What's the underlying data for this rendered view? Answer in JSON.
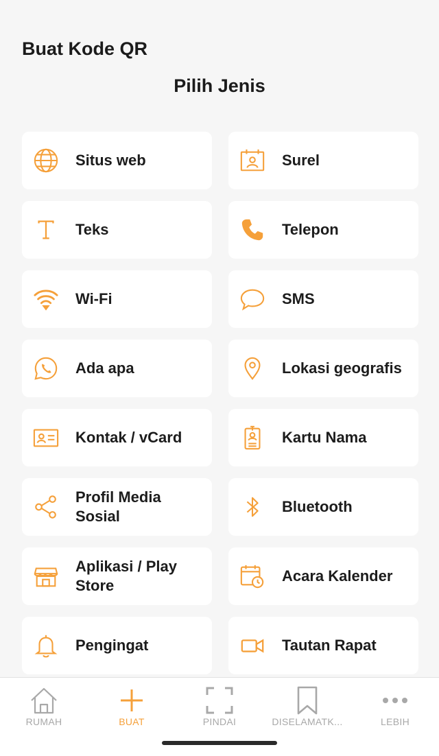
{
  "header": {
    "app_title": "Buat Kode QR",
    "section_title": "Pilih Jenis"
  },
  "colors": {
    "accent": "#f5a03a",
    "background": "#f6f6f6",
    "card": "#ffffff",
    "inactive_nav": "#a8a8a8"
  },
  "types": [
    {
      "label": "Situs web",
      "icon": "globe-icon"
    },
    {
      "label": "Surel",
      "icon": "email-card-icon"
    },
    {
      "label": "Teks",
      "icon": "text-icon"
    },
    {
      "label": "Telepon",
      "icon": "phone-icon"
    },
    {
      "label": "Wi-Fi",
      "icon": "wifi-icon"
    },
    {
      "label": "SMS",
      "icon": "chat-bubble-icon"
    },
    {
      "label": "Ada apa",
      "icon": "whatsapp-icon"
    },
    {
      "label": "Lokasi geografis",
      "icon": "location-pin-icon"
    },
    {
      "label": "Kontak / vCard",
      "icon": "contact-card-icon"
    },
    {
      "label": "Kartu Nama",
      "icon": "id-badge-icon"
    },
    {
      "label": "Profil Media Sosial",
      "icon": "share-icon"
    },
    {
      "label": "Bluetooth",
      "icon": "bluetooth-icon"
    },
    {
      "label": "Aplikasi / Play Store",
      "icon": "store-icon"
    },
    {
      "label": "Acara Kalender",
      "icon": "calendar-clock-icon"
    },
    {
      "label": "Pengingat",
      "icon": "bell-icon"
    },
    {
      "label": "Tautan Rapat",
      "icon": "video-icon"
    }
  ],
  "bottom_nav": [
    {
      "label": "RUMAH",
      "icon": "home-icon",
      "active": false
    },
    {
      "label": "BUAT",
      "icon": "plus-icon",
      "active": true
    },
    {
      "label": "PINDAI",
      "icon": "scan-icon",
      "active": false
    },
    {
      "label": "DISELAMATK...",
      "icon": "bookmark-icon",
      "active": false
    },
    {
      "label": "LEBIH",
      "icon": "more-dots-icon",
      "active": false
    }
  ]
}
